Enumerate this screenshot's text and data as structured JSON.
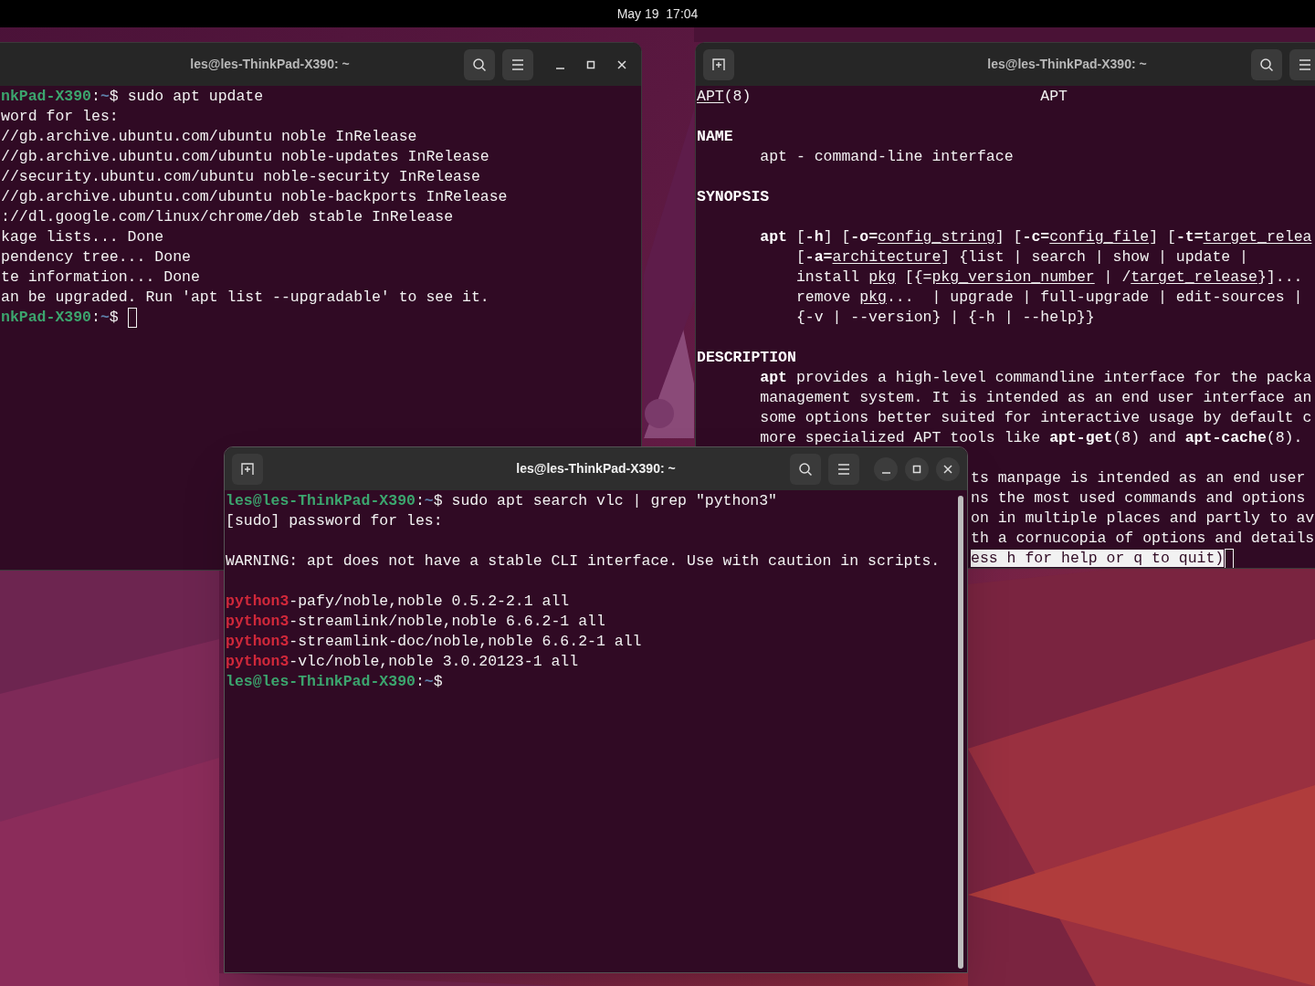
{
  "top_bar": {
    "clock": "May 19  17:04"
  },
  "windows": [
    {
      "title": "les@les-ThinkPad-X390: ~",
      "focused": false,
      "lines": [
        {
          "kind": "plain",
          "segments": [
            {
              "kind": "user",
              "text": "nkPad-X390"
            },
            {
              "kind": "plain",
              "text": ":"
            },
            {
              "kind": "path",
              "text": "~"
            },
            {
              "kind": "plain",
              "text": "$ sudo apt update"
            }
          ]
        },
        {
          "kind": "plain",
          "segments": [
            {
              "kind": "plain",
              "text": "word for les:"
            }
          ]
        },
        {
          "kind": "plain",
          "segments": [
            {
              "kind": "plain",
              "text": "//gb.archive.ubuntu.com/ubuntu noble InRelease"
            }
          ]
        },
        {
          "kind": "plain",
          "segments": [
            {
              "kind": "plain",
              "text": "//gb.archive.ubuntu.com/ubuntu noble-updates InRelease"
            }
          ]
        },
        {
          "kind": "plain",
          "segments": [
            {
              "kind": "plain",
              "text": "//security.ubuntu.com/ubuntu noble-security InRelease"
            }
          ]
        },
        {
          "kind": "plain",
          "segments": [
            {
              "kind": "plain",
              "text": "//gb.archive.ubuntu.com/ubuntu noble-backports InRelease"
            }
          ]
        },
        {
          "kind": "plain",
          "segments": [
            {
              "kind": "plain",
              "text": "://dl.google.com/linux/chrome/deb stable InRelease"
            }
          ]
        },
        {
          "kind": "plain",
          "segments": [
            {
              "kind": "plain",
              "text": "kage lists... Done"
            }
          ]
        },
        {
          "kind": "plain",
          "segments": [
            {
              "kind": "plain",
              "text": "pendency tree... Done"
            }
          ]
        },
        {
          "kind": "plain",
          "segments": [
            {
              "kind": "plain",
              "text": "te information... Done"
            }
          ]
        },
        {
          "kind": "plain",
          "segments": [
            {
              "kind": "plain",
              "text": "an be upgraded. Run 'apt list --upgradable' to see it."
            }
          ]
        },
        {
          "kind": "plain",
          "cursor": true,
          "segments": [
            {
              "kind": "user",
              "text": "nkPad-X390"
            },
            {
              "kind": "plain",
              "text": ":"
            },
            {
              "kind": "path",
              "text": "~"
            },
            {
              "kind": "plain",
              "text": "$"
            }
          ]
        }
      ]
    },
    {
      "title": "les@les-ThinkPad-X390: ~",
      "focused": false,
      "lines": [
        {
          "kind": "header",
          "title": "APT",
          "segments": [
            {
              "kind": "underline",
              "text": "APT"
            },
            {
              "kind": "plain",
              "text": "(8)"
            }
          ]
        },
        {
          "kind": "blank"
        },
        {
          "kind": "plain",
          "segments": [
            {
              "kind": "bold",
              "text": "NAME"
            }
          ]
        },
        {
          "kind": "indented",
          "segments": [
            {
              "kind": "plain",
              "text": "apt - command-line interface"
            }
          ]
        },
        {
          "kind": "blank"
        },
        {
          "kind": "plain",
          "segments": [
            {
              "kind": "bold",
              "text": "SYNOPSIS"
            }
          ]
        },
        {
          "kind": "blank"
        },
        {
          "kind": "indented",
          "segments": [
            {
              "kind": "bold",
              "text": "apt"
            },
            {
              "kind": "plain",
              "text": " ["
            },
            {
              "kind": "bold",
              "text": "-h"
            },
            {
              "kind": "plain",
              "text": "] ["
            },
            {
              "kind": "bold",
              "text": "-o="
            },
            {
              "kind": "underline",
              "text": "config_string"
            },
            {
              "kind": "plain",
              "text": "] ["
            },
            {
              "kind": "bold",
              "text": "-c="
            },
            {
              "kind": "underline",
              "text": "config_file"
            },
            {
              "kind": "plain",
              "text": "] ["
            },
            {
              "kind": "bold",
              "text": "-t="
            },
            {
              "kind": "underline",
              "text": "target_relea"
            }
          ]
        },
        {
          "kind": "continuation",
          "segments": [
            {
              "kind": "plain",
              "text": "["
            },
            {
              "kind": "bold",
              "text": "-a="
            },
            {
              "kind": "underline",
              "text": "architecture"
            },
            {
              "kind": "plain",
              "text": "] {list | search | show | update |"
            }
          ]
        },
        {
          "kind": "continuation",
          "segments": [
            {
              "kind": "plain",
              "text": "install "
            },
            {
              "kind": "underline",
              "text": "pkg"
            },
            {
              "kind": "plain",
              "text": " [{="
            },
            {
              "kind": "underline",
              "text": "pkg_version_number"
            },
            {
              "kind": "plain",
              "text": " | /"
            },
            {
              "kind": "underline",
              "text": "target_release"
            },
            {
              "kind": "plain",
              "text": "}]..."
            }
          ]
        },
        {
          "kind": "continuation",
          "segments": [
            {
              "kind": "plain",
              "text": "remove "
            },
            {
              "kind": "underline",
              "text": "pkg"
            },
            {
              "kind": "plain",
              "text": "...  | upgrade | full-upgrade | edit-sources |"
            }
          ]
        },
        {
          "kind": "continuation",
          "segments": [
            {
              "kind": "plain",
              "text": "{-v | --version} | {-h | --help}}"
            }
          ]
        },
        {
          "kind": "blank"
        },
        {
          "kind": "plain",
          "segments": [
            {
              "kind": "bold",
              "text": "DESCRIPTION"
            }
          ]
        },
        {
          "kind": "indented",
          "segments": [
            {
              "kind": "bold",
              "text": "apt"
            },
            {
              "kind": "plain",
              "text": " provides a high-level commandline interface for the packa"
            }
          ]
        },
        {
          "kind": "indented",
          "segments": [
            {
              "kind": "plain",
              "text": "management system. It is intended as an end user interface an"
            }
          ]
        },
        {
          "kind": "indented",
          "segments": [
            {
              "kind": "plain",
              "text": "some options better suited for interactive usage by default c"
            }
          ]
        },
        {
          "kind": "indented",
          "segments": [
            {
              "kind": "plain",
              "text": "more specialized APT tools like "
            },
            {
              "kind": "bold",
              "text": "apt-get"
            },
            {
              "kind": "plain",
              "text": "(8) and "
            },
            {
              "kind": "bold",
              "text": "apt-cache"
            },
            {
              "kind": "plain",
              "text": "(8)."
            }
          ]
        },
        {
          "kind": "blank"
        },
        {
          "kind": "partial",
          "segments": [
            {
              "kind": "plain",
              "text": "ts manpage is intended as an end user"
            }
          ]
        },
        {
          "kind": "partial",
          "segments": [
            {
              "kind": "plain",
              "text": "ns the most used commands and options"
            }
          ]
        },
        {
          "kind": "partial",
          "segments": [
            {
              "kind": "plain",
              "text": "on in multiple places and partly to av"
            }
          ]
        },
        {
          "kind": "partial",
          "segments": [
            {
              "kind": "plain",
              "text": "th a cornucopia of options and details"
            }
          ]
        },
        {
          "kind": "partial",
          "cursor": true,
          "segments": [
            {
              "kind": "reverse",
              "text": "ess h for help or q to quit)"
            }
          ]
        }
      ]
    },
    {
      "title": "les@les-ThinkPad-X390: ~",
      "focused": true,
      "lines": [
        {
          "kind": "plain",
          "segments": [
            {
              "kind": "user",
              "text": "les@les-ThinkPad-X390"
            },
            {
              "kind": "plain",
              "text": ":"
            },
            {
              "kind": "path",
              "text": "~"
            },
            {
              "kind": "plain",
              "text": "$ sudo apt search vlc | grep \"python3\""
            }
          ]
        },
        {
          "kind": "plain",
          "segments": [
            {
              "kind": "plain",
              "text": "[sudo] password for les:"
            }
          ]
        },
        {
          "kind": "blank"
        },
        {
          "kind": "plain",
          "segments": [
            {
              "kind": "plain",
              "text": "WARNING: apt does not have a stable CLI interface. Use with caution in scripts."
            }
          ]
        },
        {
          "kind": "blank"
        },
        {
          "kind": "plain",
          "segments": [
            {
              "kind": "match",
              "text": "python3"
            },
            {
              "kind": "plain",
              "text": "-pafy/noble,noble 0.5.2-2.1 all"
            }
          ]
        },
        {
          "kind": "plain",
          "segments": [
            {
              "kind": "match",
              "text": "python3"
            },
            {
              "kind": "plain",
              "text": "-streamlink/noble,noble 6.6.2-1 all"
            }
          ]
        },
        {
          "kind": "plain",
          "segments": [
            {
              "kind": "match",
              "text": "python3"
            },
            {
              "kind": "plain",
              "text": "-streamlink-doc/noble,noble 6.6.2-1 all"
            }
          ]
        },
        {
          "kind": "plain",
          "segments": [
            {
              "kind": "match",
              "text": "python3"
            },
            {
              "kind": "plain",
              "text": "-vlc/noble,noble 3.0.20123-1 all"
            }
          ]
        },
        {
          "kind": "plain",
          "segments": [
            {
              "kind": "user",
              "text": "les@les-ThinkPad-X390"
            },
            {
              "kind": "plain",
              "text": ":"
            },
            {
              "kind": "path",
              "text": "~"
            },
            {
              "kind": "plain",
              "text": "$"
            }
          ]
        }
      ]
    }
  ]
}
